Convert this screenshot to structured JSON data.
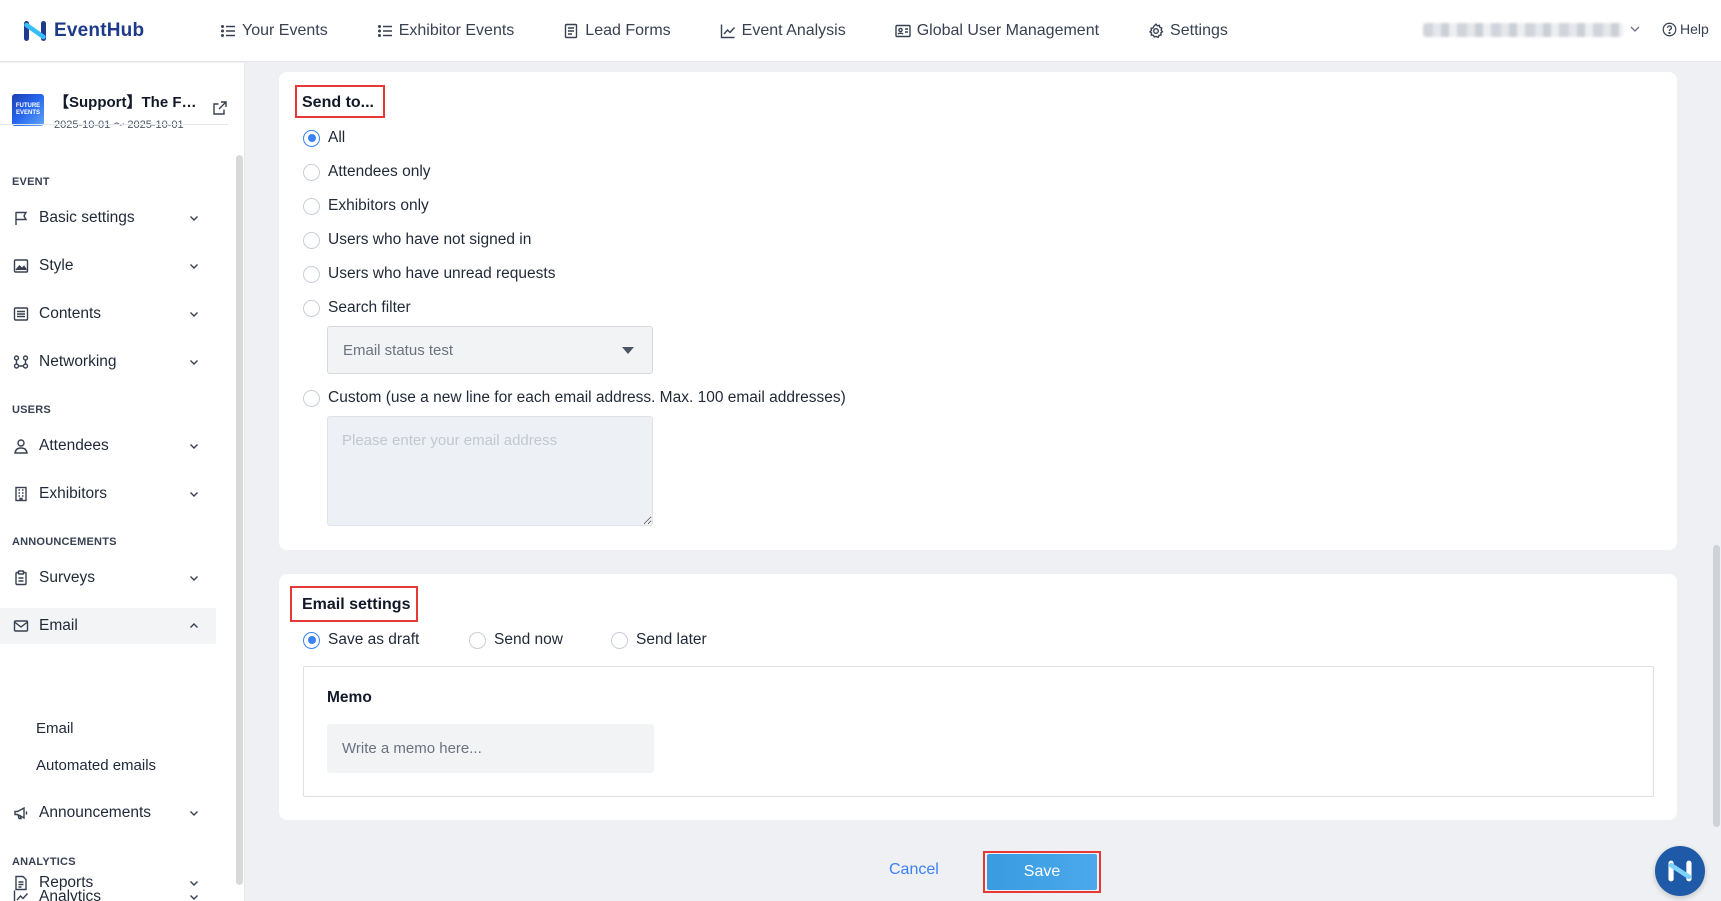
{
  "brand": {
    "name": "EventHub",
    "color": "#1e3a8a",
    "logo_icon": "eventhub-logo-icon"
  },
  "topnav": {
    "items": [
      {
        "label": "Your Events",
        "icon": "list-icon"
      },
      {
        "label": "Exhibitor Events",
        "icon": "list-icon"
      },
      {
        "label": "Lead Forms",
        "icon": "form-icon"
      },
      {
        "label": "Event Analysis",
        "icon": "line-chart-icon"
      },
      {
        "label": "Global User Management",
        "icon": "id-card-icon"
      },
      {
        "label": "Settings",
        "icon": "gear-icon"
      }
    ],
    "help_label": "Help"
  },
  "event": {
    "thumb_text": "FUTURE EVENTS",
    "title": "【Support】The F…",
    "dates": "2025-10-01 ～ 2025-10-01"
  },
  "sidebar": {
    "sections": {
      "event": "EVENT",
      "users": "USERS",
      "announcements": "ANNOUNCEMENTS",
      "analytics": "ANALYTICS"
    },
    "items": {
      "basic_settings": "Basic settings",
      "style": "Style",
      "contents": "Contents",
      "networking": "Networking",
      "attendees": "Attendees",
      "exhibitors": "Exhibitors",
      "surveys": "Surveys",
      "email": "Email",
      "announcements": "Announcements",
      "analytics": "Analytics",
      "reports": "Reports"
    },
    "email_sub": {
      "email": "Email",
      "automated": "Automated emails"
    }
  },
  "send_to": {
    "title": "Send to...",
    "options": {
      "all": "All",
      "attendees": "Attendees only",
      "exhibitors": "Exhibitors only",
      "not_signed_in": "Users who have not signed in",
      "unread": "Users who have unread requests",
      "search_filter": "Search filter",
      "custom": "Custom (use a new line for each email address. Max. 100 email addresses)"
    },
    "selected": "All",
    "filter_value": "Email status test",
    "custom_placeholder": "Please enter your email address"
  },
  "email_settings": {
    "title": "Email settings",
    "options": {
      "draft": "Save as draft",
      "now": "Send now",
      "later": "Send later"
    },
    "selected": "Save as draft",
    "memo_label": "Memo",
    "memo_placeholder": "Write a memo here..."
  },
  "actions": {
    "cancel": "Cancel",
    "save": "Save"
  },
  "colors": {
    "accent": "#3b82f6",
    "highlight": "#e53935",
    "save_button": "#3a9be0"
  }
}
